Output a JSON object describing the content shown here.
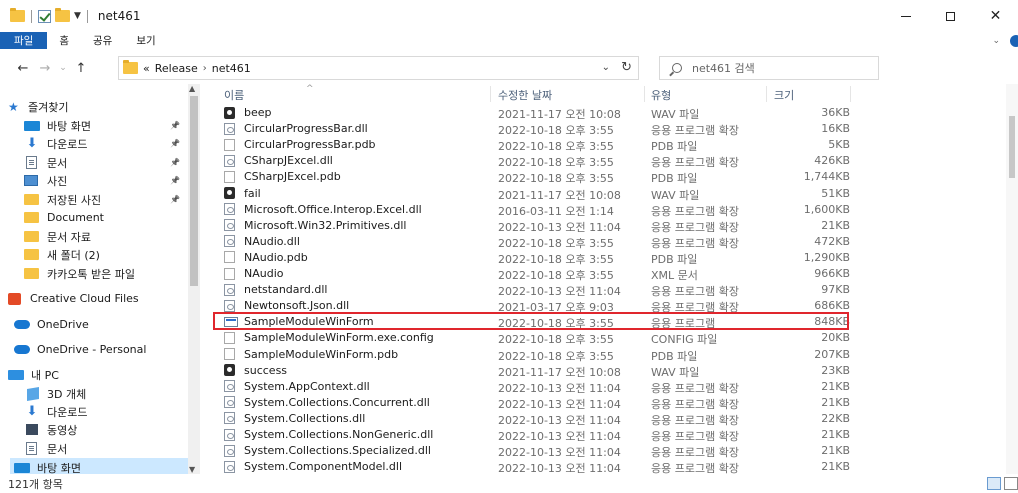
{
  "window": {
    "title": "net461"
  },
  "ribbon": {
    "tabs": [
      "파일",
      "홈",
      "공유",
      "보기"
    ]
  },
  "address": {
    "prefix": "«",
    "crumbs": [
      "Release",
      "net461"
    ],
    "search_placeholder": "net461 검색"
  },
  "sidebar": {
    "items": [
      {
        "label": "즐겨찾기",
        "icon": "star-icon",
        "pinned": false
      },
      {
        "label": "바탕 화면",
        "icon": "desktop-icon",
        "pinned": true
      },
      {
        "label": "다운로드",
        "icon": "download-icon",
        "pinned": true
      },
      {
        "label": "문서",
        "icon": "document-icon",
        "pinned": true
      },
      {
        "label": "사진",
        "icon": "picture-icon",
        "pinned": true
      },
      {
        "label": "저장된 사진",
        "icon": "folder-icon",
        "pinned": true
      },
      {
        "label": "Document",
        "icon": "folder-icon",
        "pinned": false
      },
      {
        "label": "문서 자료",
        "icon": "folder-icon",
        "pinned": false
      },
      {
        "label": "새 폴더 (2)",
        "icon": "folder-icon",
        "pinned": false
      },
      {
        "label": "카카오톡 받은 파일",
        "icon": "folder-icon",
        "pinned": false
      },
      {
        "label": "Creative Cloud Files",
        "icon": "creative-cloud-icon",
        "pinned": false
      },
      {
        "label": "OneDrive",
        "icon": "cloud-icon",
        "pinned": false
      },
      {
        "label": "OneDrive - Personal",
        "icon": "cloud-icon",
        "pinned": false
      },
      {
        "label": "내 PC",
        "icon": "pc-icon",
        "pinned": false
      },
      {
        "label": "3D 개체",
        "icon": "3d-objects-icon",
        "pinned": false
      },
      {
        "label": "다운로드",
        "icon": "download-icon",
        "pinned": false
      },
      {
        "label": "동영상",
        "icon": "video-icon",
        "pinned": false
      },
      {
        "label": "문서",
        "icon": "document-icon",
        "pinned": false
      },
      {
        "label": "바탕 화면",
        "icon": "desktop-icon",
        "pinned": false,
        "selected": true
      }
    ]
  },
  "columns": {
    "name": "이름",
    "date": "수정한 날짜",
    "type": "유형",
    "size": "크기"
  },
  "files": [
    {
      "name": "beep",
      "date": "2021-11-17 오전 10:08",
      "type": "WAV 파일",
      "size": "36KB",
      "icon": "wav"
    },
    {
      "name": "CircularProgressBar.dll",
      "date": "2022-10-18 오후 3:55",
      "type": "응용 프로그램 확장",
      "size": "16KB",
      "icon": "dll"
    },
    {
      "name": "CircularProgressBar.pdb",
      "date": "2022-10-18 오후 3:55",
      "type": "PDB 파일",
      "size": "5KB",
      "icon": "blank"
    },
    {
      "name": "CSharpJExcel.dll",
      "date": "2022-10-18 오후 3:55",
      "type": "응용 프로그램 확장",
      "size": "426KB",
      "icon": "dll"
    },
    {
      "name": "CSharpJExcel.pdb",
      "date": "2022-10-18 오후 3:55",
      "type": "PDB 파일",
      "size": "1,744KB",
      "icon": "blank"
    },
    {
      "name": "fail",
      "date": "2021-11-17 오전 10:08",
      "type": "WAV 파일",
      "size": "51KB",
      "icon": "wav"
    },
    {
      "name": "Microsoft.Office.Interop.Excel.dll",
      "date": "2016-03-11 오전 1:14",
      "type": "응용 프로그램 확장",
      "size": "1,600KB",
      "icon": "dll"
    },
    {
      "name": "Microsoft.Win32.Primitives.dll",
      "date": "2022-10-13 오전 11:04",
      "type": "응용 프로그램 확장",
      "size": "21KB",
      "icon": "dll"
    },
    {
      "name": "NAudio.dll",
      "date": "2022-10-18 오후 3:55",
      "type": "응용 프로그램 확장",
      "size": "472KB",
      "icon": "dll"
    },
    {
      "name": "NAudio.pdb",
      "date": "2022-10-18 오후 3:55",
      "type": "PDB 파일",
      "size": "1,290KB",
      "icon": "blank"
    },
    {
      "name": "NAudio",
      "date": "2022-10-18 오후 3:55",
      "type": "XML 문서",
      "size": "966KB",
      "icon": "blank"
    },
    {
      "name": "netstandard.dll",
      "date": "2022-10-13 오전 11:04",
      "type": "응용 프로그램 확장",
      "size": "97KB",
      "icon": "dll"
    },
    {
      "name": "Newtonsoft.Json.dll",
      "date": "2021-03-17 오후 9:03",
      "type": "응용 프로그램 확장",
      "size": "686KB",
      "icon": "dll"
    },
    {
      "name": "SampleModuleWinForm",
      "date": "2022-10-18 오후 3:55",
      "type": "응용 프로그램",
      "size": "848KB",
      "icon": "exe",
      "highlighted": true
    },
    {
      "name": "SampleModuleWinForm.exe.config",
      "date": "2022-10-18 오후 3:55",
      "type": "CONFIG 파일",
      "size": "20KB",
      "icon": "blank"
    },
    {
      "name": "SampleModuleWinForm.pdb",
      "date": "2022-10-18 오후 3:55",
      "type": "PDB 파일",
      "size": "207KB",
      "icon": "blank"
    },
    {
      "name": "success",
      "date": "2021-11-17 오전 10:08",
      "type": "WAV 파일",
      "size": "23KB",
      "icon": "wav"
    },
    {
      "name": "System.AppContext.dll",
      "date": "2022-10-13 오전 11:04",
      "type": "응용 프로그램 확장",
      "size": "21KB",
      "icon": "dll"
    },
    {
      "name": "System.Collections.Concurrent.dll",
      "date": "2022-10-13 오전 11:04",
      "type": "응용 프로그램 확장",
      "size": "21KB",
      "icon": "dll"
    },
    {
      "name": "System.Collections.dll",
      "date": "2022-10-13 오전 11:04",
      "type": "응용 프로그램 확장",
      "size": "22KB",
      "icon": "dll"
    },
    {
      "name": "System.Collections.NonGeneric.dll",
      "date": "2022-10-13 오전 11:04",
      "type": "응용 프로그램 확장",
      "size": "21KB",
      "icon": "dll"
    },
    {
      "name": "System.Collections.Specialized.dll",
      "date": "2022-10-13 오전 11:04",
      "type": "응용 프로그램 확장",
      "size": "21KB",
      "icon": "dll"
    },
    {
      "name": "System.ComponentModel.dll",
      "date": "2022-10-13 오전 11:04",
      "type": "응용 프로그램 확장",
      "size": "21KB",
      "icon": "dll"
    }
  ],
  "status": {
    "item_count": "121개 항목"
  },
  "colors": {
    "accent": "#1a62b5",
    "selection": "#cce8ff",
    "highlight_border": "#e0262d"
  }
}
